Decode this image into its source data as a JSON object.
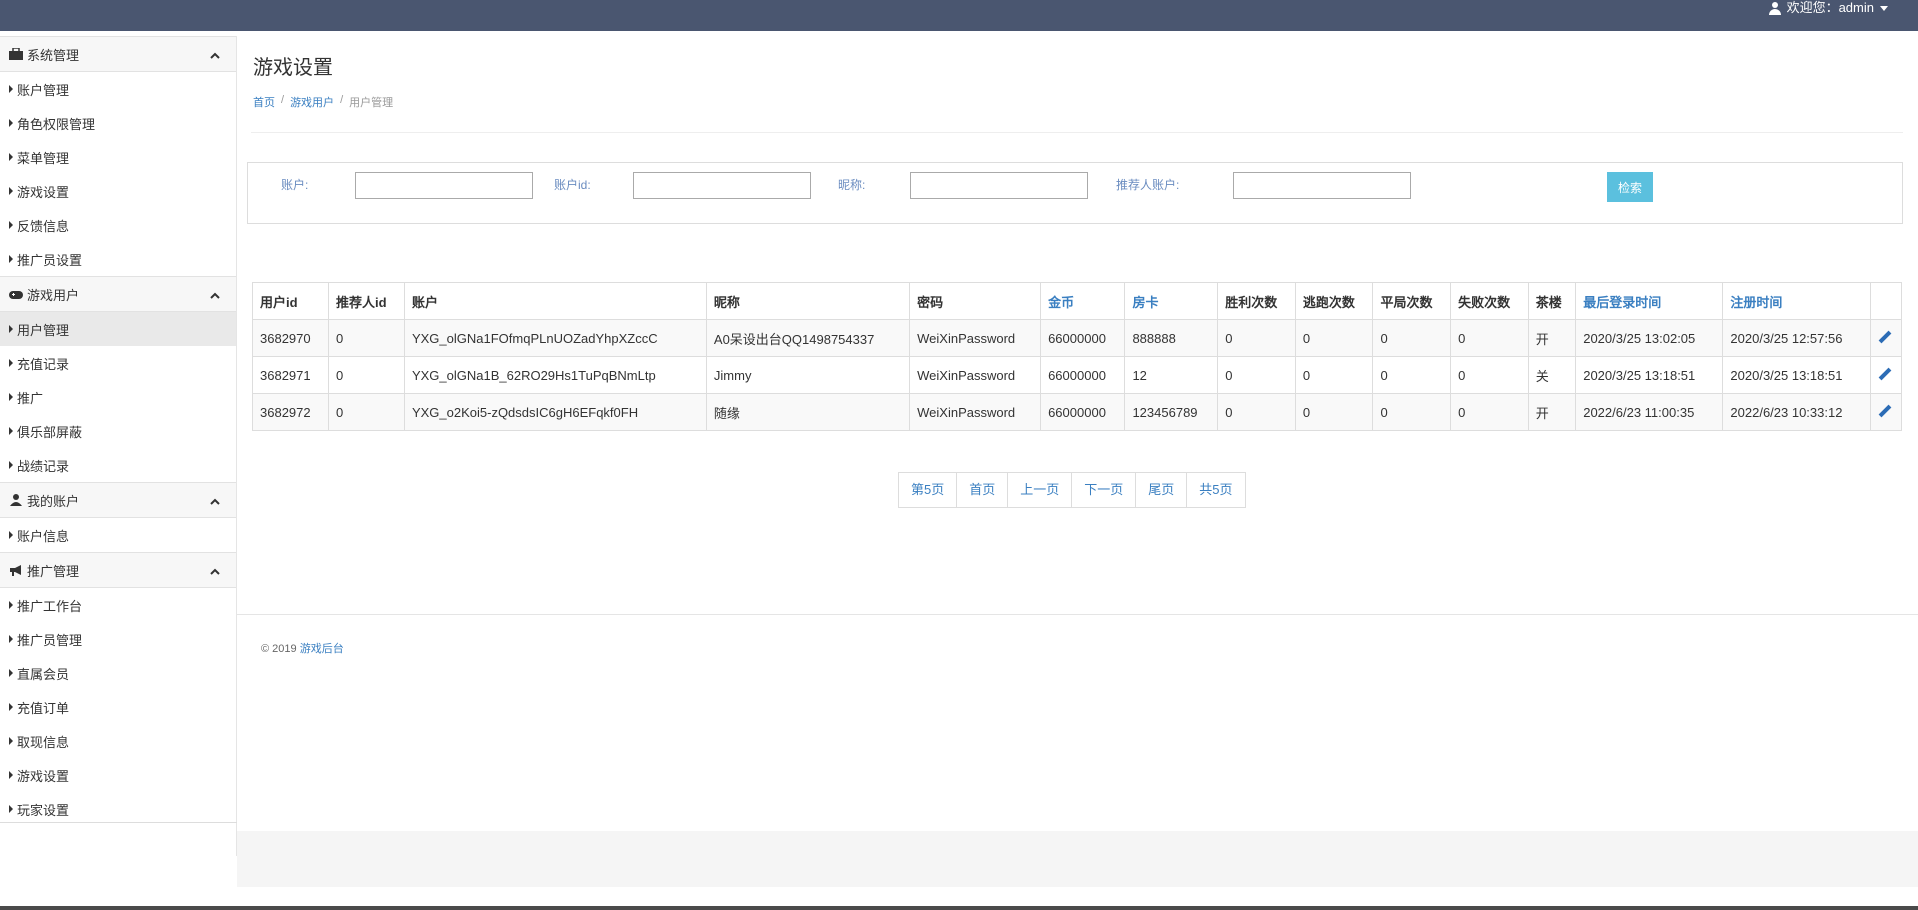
{
  "header": {
    "welcome": "欢迎您：admin"
  },
  "sidebar": {
    "groups": [
      {
        "title": "系统管理",
        "icon": "briefcase-icon",
        "items": [
          "账户管理",
          "角色权限管理",
          "菜单管理",
          "游戏设置",
          "反馈信息",
          "推广员设置"
        ]
      },
      {
        "title": "游戏用户",
        "icon": "gamepad-icon",
        "items": [
          "用户管理",
          "充值记录",
          "推广",
          "俱乐部屏蔽",
          "战绩记录"
        ]
      },
      {
        "title": "我的账户",
        "icon": "user-icon",
        "items": [
          "账户信息"
        ]
      },
      {
        "title": "推广管理",
        "icon": "bullhorn-icon",
        "items": [
          "推广工作台",
          "推广员管理",
          "直属会员",
          "充值订单",
          "取现信息",
          "游戏设置",
          "玩家设置"
        ]
      }
    ],
    "active_item": "用户管理"
  },
  "page": {
    "title": "游戏设置",
    "breadcrumb": [
      "首页",
      "游戏用户",
      "用户管理"
    ],
    "breadcrumb_sep": "/"
  },
  "search": {
    "account_label": "账户:",
    "account_id_label": "账户id:",
    "nickname_label": "昵称:",
    "referrer_label": "推荐人账户:",
    "button": "检索"
  },
  "table": {
    "columns": [
      "用户id",
      "推荐人id",
      "账户",
      "昵称",
      "密码",
      "金币",
      "房卡",
      "胜利次数",
      "逃跑次数",
      "平局次数",
      "失败次数",
      "茶楼",
      "最后登录时间",
      "注册时间",
      ""
    ],
    "rows": [
      [
        "3682970",
        "0",
        "YXG_olGNa1FOfmqPLnUOZadYhpXZccC",
        "A0呆设出台QQ1498754337",
        "WeiXinPassword",
        "66000000",
        "888888",
        "0",
        "0",
        "0",
        "0",
        "开",
        "2020/3/25 13:02:05",
        "2020/3/25 12:57:56"
      ],
      [
        "3682971",
        "0",
        "YXG_olGNa1B_62RO29Hs1TuPqBNmLtp",
        "Jimmy",
        "WeiXinPassword",
        "66000000",
        "12",
        "0",
        "0",
        "0",
        "0",
        "关",
        "2020/3/25 13:18:51",
        "2020/3/25 13:18:51"
      ],
      [
        "3682972",
        "0",
        "YXG_o2Koi5-zQdsdsIC6gH6EFqkf0FH",
        "随缘",
        "WeiXinPassword",
        "66000000",
        "123456789",
        "0",
        "0",
        "0",
        "0",
        "开",
        "2022/6/23 11:00:35",
        "2022/6/23 10:33:12"
      ]
    ]
  },
  "pagination": [
    "第5页",
    "首页",
    "上一页",
    "下一页",
    "尾页",
    "共5页"
  ],
  "footer": {
    "copyright": "© 2019",
    "link": "游戏后台"
  },
  "colors": {
    "topbar": "#4a5670",
    "link": "#3a7fc1",
    "search_button": "#5bc0de",
    "edit_icon": "#2c6cb5"
  }
}
